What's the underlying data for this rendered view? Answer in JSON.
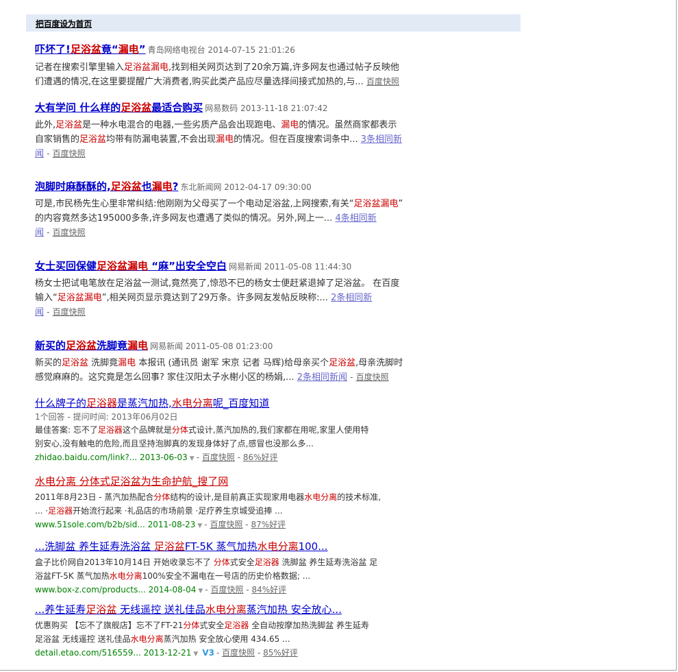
{
  "topbar": {
    "set_home": "把百度设为首页"
  },
  "results": [
    {
      "title_parts": [
        {
          "t": "吓坏了!",
          "hl": false
        },
        {
          "t": "足浴盆",
          "hl": true
        },
        {
          "t": "竟“",
          "hl": false
        },
        {
          "t": "漏电",
          "hl": true
        },
        {
          "t": "”",
          "hl": false
        }
      ],
      "source": "青岛网络电视台 2014-07-15 21:01:26",
      "line1": [
        {
          "t": "记者在搜索引擎里输入",
          "hl": false
        },
        {
          "t": "足浴盆漏电",
          "hl": true
        },
        {
          "t": ",找到相关网页达到了20余万篇,许多网友也通过帖子反映他",
          "hl": false
        }
      ],
      "line2": [
        {
          "t": "们遭遇的情况,在这里要提醒广大消费者,购买此类产品应尽量选择间接式加热的,与...",
          "hl": false
        }
      ],
      "cache": "百度快照"
    },
    {
      "title_parts": [
        {
          "t": "大有学问 什么样的",
          "hl": false
        },
        {
          "t": "足浴盆",
          "hl": true
        },
        {
          "t": "最适合购买",
          "hl": false
        }
      ],
      "source": "网易数码 2013-11-18 21:07:42",
      "line1": [
        {
          "t": "此外,",
          "hl": false
        },
        {
          "t": "足浴盆",
          "hl": true
        },
        {
          "t": "是一种水电混合的电器,一些劣质产品会出现跑电、",
          "hl": false
        },
        {
          "t": "漏电",
          "hl": true
        },
        {
          "t": "的情况。虽然商家都表示",
          "hl": false
        }
      ],
      "line2": [
        {
          "t": "自家销售的",
          "hl": false
        },
        {
          "t": "足浴盆",
          "hl": true
        },
        {
          "t": "均带有防漏电装置,不会出现",
          "hl": false
        },
        {
          "t": "漏电",
          "hl": true
        },
        {
          "t": "的情况。但在百度搜索词条中...",
          "hl": false
        }
      ],
      "more_a": "3条相同新",
      "more_b": "闻",
      "cache": "百度快照"
    },
    {
      "title_parts": [
        {
          "t": "泡脚时麻酥酥的,",
          "hl": false
        },
        {
          "t": "足浴盆",
          "hl": true
        },
        {
          "t": "也",
          "hl": false
        },
        {
          "t": "漏电",
          "hl": true
        },
        {
          "t": "?",
          "hl": false
        }
      ],
      "source": "东北新闻网 2012-04-17 09:30:00",
      "line1": [
        {
          "t": "可是,市民杨先生心里非常纠结:他刚刚为父母买了一个电动足浴盆,上网搜索,有关“",
          "hl": false
        },
        {
          "t": "足浴盆漏电",
          "hl": true
        },
        {
          "t": "”",
          "hl": false
        }
      ],
      "line2": [
        {
          "t": "的内容竟然多达195000多条,许多网友也遭遇了类似的情况。另外,网上一...",
          "hl": false
        }
      ],
      "more_a": "4条相同新",
      "more_b": "闻",
      "cache": "百度快照"
    },
    {
      "title_parts": [
        {
          "t": "女士买回保健",
          "hl": false
        },
        {
          "t": "足浴盆漏电",
          "hl": true
        },
        {
          "t": " “麻”出安全空白",
          "hl": false
        }
      ],
      "source": "网易新闻 2011-05-08 11:44:30",
      "line1": [
        {
          "t": "杨女士把试电笔放在足浴盆一测试,竟然亮了,惊恐不已的杨女士便赶紧退掉了足浴盆。 在百度",
          "hl": false
        }
      ],
      "line2": [
        {
          "t": "输入“",
          "hl": false
        },
        {
          "t": "足浴盆漏电",
          "hl": true
        },
        {
          "t": "”,相关网页显示竟达到了29万条。许多网友发帖反映称:...",
          "hl": false
        }
      ],
      "more_a": "2条相同新",
      "more_b": "闻",
      "cache": "百度快照"
    },
    {
      "title_parts": [
        {
          "t": "新买的",
          "hl": false
        },
        {
          "t": "足浴盆",
          "hl": true
        },
        {
          "t": "洗脚竟",
          "hl": false
        },
        {
          "t": "漏电",
          "hl": true
        }
      ],
      "source": "网易新闻 2011-05-08 01:23:00",
      "line1": [
        {
          "t": "新买的",
          "hl": false
        },
        {
          "t": "足浴盆",
          "hl": true
        },
        {
          "t": " 洗脚竟",
          "hl": false
        },
        {
          "t": "漏电",
          "hl": true
        },
        {
          "t": " 本报讯 (通讯员 谢军 宋京 记者 马辉)给母亲买个",
          "hl": false
        },
        {
          "t": "足浴盆",
          "hl": true
        },
        {
          "t": ",母亲洗脚时",
          "hl": false
        }
      ],
      "line2": [
        {
          "t": "感觉麻麻的。这究竟是怎么回事? 家住汉阳太子水榭小区的杨娟,...",
          "hl": false
        }
      ],
      "more_a": "2条相同新闻",
      "cache": "百度快照"
    }
  ],
  "web_results": [
    {
      "title_parts": [
        {
          "t": "什么牌子的",
          "hl": false
        },
        {
          "t": "足浴器",
          "hl": true
        },
        {
          "t": "是蒸汽加热,",
          "hl": false
        },
        {
          "t": "水电分离",
          "hl": true
        },
        {
          "t": "呢_百度知道",
          "hl": false
        }
      ],
      "meta": "1个回答 - 提问时间: 2013年06月02日",
      "line1": [
        {
          "t": "最佳答案: 忘不了",
          "hl": false
        },
        {
          "t": "足浴器",
          "hl": true
        },
        {
          "t": "这个品牌就是",
          "hl": false
        },
        {
          "t": "分体",
          "hl": true
        },
        {
          "t": "式设计,蒸汽加热的,我们家都在用呢,家里人使用特",
          "hl": false
        }
      ],
      "line2": [
        {
          "t": "别安心,没有触电的危险,而且坚持泡脚真的发现身体好了点,感冒也没那么多...",
          "hl": false
        }
      ],
      "url": "zhidao.baidu.com/link?... 2013-06-03",
      "cache": "百度快照",
      "rating": "86%好评"
    },
    {
      "title_parts": [
        {
          "t": "水电分离 分体式",
          "hl": false
        },
        {
          "t": "足浴盆",
          "hl": false
        },
        {
          "t": "为生命护航_搜了网",
          "hl": false
        }
      ],
      "meta": "",
      "line1": [
        {
          "t": "2011年8月23日 - 蒸汽加热配合",
          "hl": false
        },
        {
          "t": "分体",
          "hl": true
        },
        {
          "t": "结构的设计,是目前真正实现家用电器",
          "hl": false
        },
        {
          "t": "水电分离",
          "hl": true
        },
        {
          "t": "的技术标准,",
          "hl": false
        }
      ],
      "line2": [
        {
          "t": "... ·",
          "hl": false
        },
        {
          "t": "足浴器",
          "hl": true
        },
        {
          "t": "开始流行起来 ·礼品店的市场前景 ·足疗养生京城受追捧 ...",
          "hl": false
        }
      ],
      "url": "www.51sole.com/b2b/sid... 2011-08-23",
      "cache": "百度快照",
      "rating": "87%好评"
    },
    {
      "title_parts": [
        {
          "t": "...洗脚盆 养生延寿洗浴盆 ",
          "hl": false
        },
        {
          "t": "足浴盆",
          "hl": true
        },
        {
          "t": "FT-5K 蒸气加热",
          "hl": false
        },
        {
          "t": "水电分离",
          "hl": true
        },
        {
          "t": "100...",
          "hl": false
        }
      ],
      "meta": "",
      "line1": [
        {
          "t": "盒子比价网自2013年10月14日 开始收录忘不了 ",
          "hl": false
        },
        {
          "t": "分体",
          "hl": true
        },
        {
          "t": "式安全",
          "hl": false
        },
        {
          "t": "足浴器",
          "hl": true
        },
        {
          "t": " 洗脚盆 养生延寿洗浴盆 足",
          "hl": false
        }
      ],
      "line2": [
        {
          "t": "浴盆FT-5K 蒸气加热",
          "hl": false
        },
        {
          "t": "水电分离",
          "hl": true
        },
        {
          "t": "100%安全不漏电在一号店的历史价格数据; ...",
          "hl": false
        }
      ],
      "url": "www.box-z.com/products... 2014-08-04",
      "cache": "百度快照",
      "rating": "84%好评"
    },
    {
      "title_parts": [
        {
          "t": "...养生延寿",
          "hl": false
        },
        {
          "t": "足浴盆",
          "hl": true
        },
        {
          "t": " 无线遥控 送礼佳品",
          "hl": false
        },
        {
          "t": "水电分离",
          "hl": true
        },
        {
          "t": "蒸汽加热 安全放心...",
          "hl": false
        }
      ],
      "meta": "",
      "line1": [
        {
          "t": "优惠购买 【忘不了旗舰店】忘不了FT-21",
          "hl": false
        },
        {
          "t": "分体",
          "hl": true
        },
        {
          "t": "式安全",
          "hl": false
        },
        {
          "t": "足浴器",
          "hl": true
        },
        {
          "t": " 全自动按摩加热洗脚盆 养生延寿",
          "hl": false
        }
      ],
      "line2": [
        {
          "t": "足浴盆 无线遥控 送礼佳品",
          "hl": false
        },
        {
          "t": "水电分离",
          "hl": true
        },
        {
          "t": "蒸汽加热 安全放心使用 434.65 ...",
          "hl": false
        }
      ],
      "url": "detail.etao.com/516559... 2013-12-21",
      "v_badge": "V3",
      "cache": "百度快照",
      "rating": "85%好评"
    }
  ]
}
